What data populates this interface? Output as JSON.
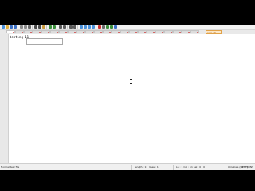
{
  "app": {
    "title": "Notepad++"
  },
  "toolbar": {
    "icons": [
      {
        "name": "new-file-icon",
        "color": "#4a90d9"
      },
      {
        "name": "open-file-icon",
        "color": "#e2b13c"
      },
      {
        "name": "save-icon",
        "color": "#3b6fc4"
      },
      {
        "name": "save-all-icon",
        "color": "#3b6fc4"
      },
      {
        "name": "close-icon",
        "color": "#8a8a8a"
      },
      {
        "name": "close-all-icon",
        "color": "#8a8a8a"
      },
      {
        "name": "print-icon",
        "color": "#6a6a6a"
      },
      {
        "name": "cut-icon",
        "color": "#4a4a4a"
      },
      {
        "name": "copy-icon",
        "color": "#4a4a4a"
      },
      {
        "name": "paste-icon",
        "color": "#c99a3b"
      },
      {
        "name": "undo-icon",
        "color": "#3b8f3b"
      },
      {
        "name": "redo-icon",
        "color": "#3b8f3b"
      },
      {
        "name": "find-icon",
        "color": "#5a5a5a"
      },
      {
        "name": "replace-icon",
        "color": "#5a5a5a"
      },
      {
        "name": "zoom-in-icon",
        "color": "#5a5a5a"
      },
      {
        "name": "zoom-out-icon",
        "color": "#5a5a5a"
      },
      {
        "name": "sync-scroll-icon",
        "color": "#4a90d9"
      },
      {
        "name": "word-wrap-icon",
        "color": "#4a90d9"
      },
      {
        "name": "show-all-chars-icon",
        "color": "#4a90d9"
      },
      {
        "name": "indent-guide-icon",
        "color": "#4a90d9"
      },
      {
        "name": "macro-record-icon",
        "color": "#d03030"
      },
      {
        "name": "macro-stop-icon",
        "color": "#6a6a6a"
      },
      {
        "name": "macro-play-icon",
        "color": "#3b8f3b"
      },
      {
        "name": "macro-run-multiple-icon",
        "color": "#3b8f3b"
      },
      {
        "name": "macro-save-icon",
        "color": "#3b6fc4"
      }
    ]
  },
  "tabs": {
    "count": 22,
    "active_index": 0,
    "highlighted_tab_label": "new 15"
  },
  "editor": {
    "line_text": "testing 11"
  },
  "statusbar": {
    "file_type": "Normal text file",
    "length": "length : 11",
    "lines": "lines : 1",
    "position": "Ln : 1    Col : 11    Sel : 0 | 0",
    "eol": "Windows (CR LF)",
    "encoding": "UTF-8",
    "mode": "INS"
  }
}
